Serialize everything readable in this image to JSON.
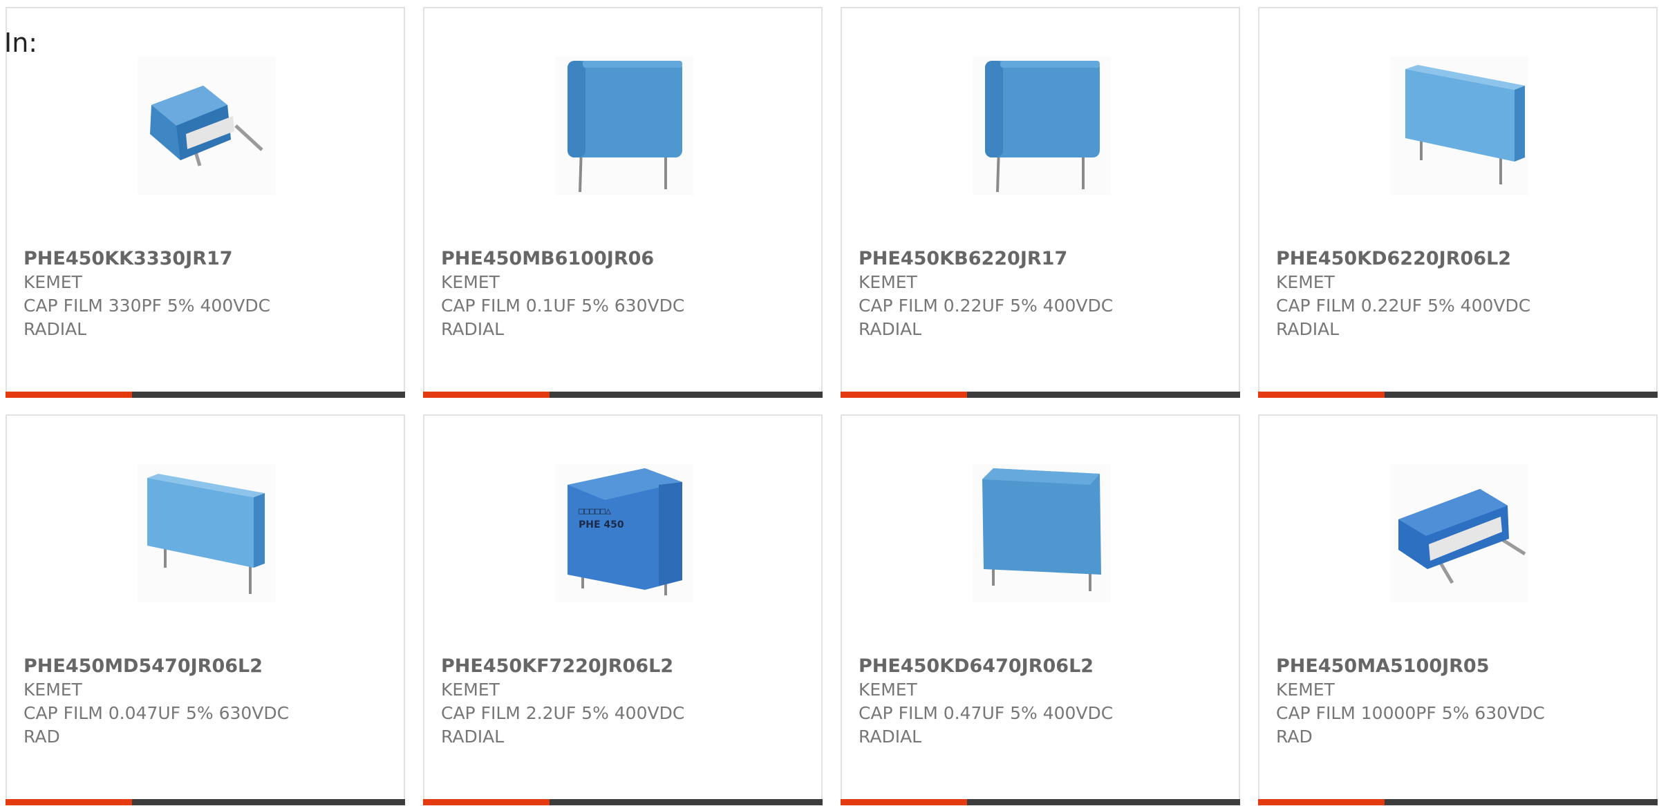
{
  "header": {
    "in_label": "In:"
  },
  "colors": {
    "accent": "#e5390f",
    "bar_dark": "#3c3c3c",
    "card_border": "#e1e1e1",
    "text": "#777777",
    "capacitor_blue": "#4f98cf"
  },
  "products": [
    {
      "part_number": "PHE450KK3330JR17",
      "manufacturer": "KEMET",
      "desc_line1": "CAP FILM 330PF 5% 400VDC",
      "desc_line2": "RADIAL",
      "image_icon": "capacitor-small-tilted-icon"
    },
    {
      "part_number": "PHE450MB6100JR06",
      "manufacturer": "KEMET",
      "desc_line1": "CAP FILM 0.1UF 5% 630VDC",
      "desc_line2": "RADIAL",
      "image_icon": "capacitor-upright-icon"
    },
    {
      "part_number": "PHE450KB6220JR17",
      "manufacturer": "KEMET",
      "desc_line1": "CAP FILM 0.22UF 5% 400VDC",
      "desc_line2": "RADIAL",
      "image_icon": "capacitor-upright-icon"
    },
    {
      "part_number": "PHE450KD6220JR06L2",
      "manufacturer": "KEMET",
      "desc_line1": "CAP FILM 0.22UF 5% 400VDC",
      "desc_line2": "RADIAL",
      "image_icon": "capacitor-wide-angled-icon"
    },
    {
      "part_number": "PHE450MD5470JR06L2",
      "manufacturer": "KEMET",
      "desc_line1": "CAP FILM 0.047UF 5% 630VDC",
      "desc_line2": "RAD",
      "image_icon": "capacitor-wide-angled-icon"
    },
    {
      "part_number": "PHE450KF7220JR06L2",
      "manufacturer": "KEMET",
      "desc_line1": "CAP FILM 2.2UF 5% 400VDC",
      "desc_line2": "RADIAL",
      "image_icon": "capacitor-labeled-icon",
      "image_text_top": "□□□□□△",
      "image_text": "PHE 450"
    },
    {
      "part_number": "PHE450KD6470JR06L2",
      "manufacturer": "KEMET",
      "desc_line1": "CAP FILM 0.47UF 5% 400VDC",
      "desc_line2": "RADIAL",
      "image_icon": "capacitor-wide-icon"
    },
    {
      "part_number": "PHE450MA5100JR05",
      "manufacturer": "KEMET",
      "desc_line1": "CAP FILM 10000PF 5% 630VDC",
      "desc_line2": "RAD",
      "image_icon": "capacitor-small-tilted-icon"
    }
  ]
}
